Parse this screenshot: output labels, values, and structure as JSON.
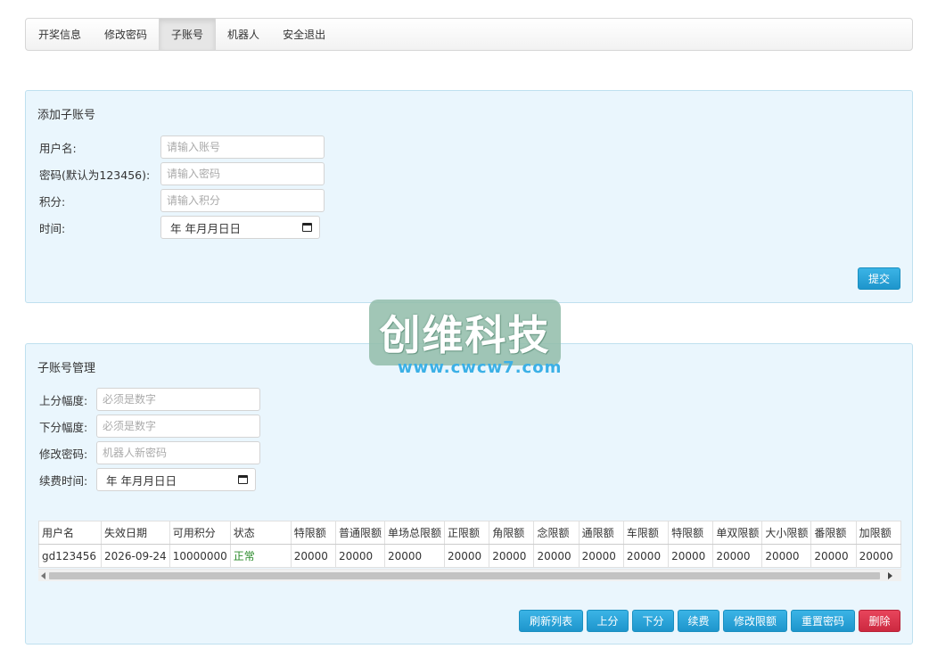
{
  "nav": {
    "items": [
      {
        "label": "开奖信息"
      },
      {
        "label": "修改密码"
      },
      {
        "label": "子账号"
      },
      {
        "label": "机器人"
      },
      {
        "label": "安全退出"
      }
    ],
    "active_index": 2
  },
  "add_panel": {
    "title": "添加子账号",
    "username_label": "用户名:",
    "username_placeholder": "请输入账号",
    "password_label": "密码(默认为123456):",
    "password_placeholder": "请输入密码",
    "points_label": "积分:",
    "points_placeholder": "请输入积分",
    "time_label": "时间:",
    "time_value": "年 年月月日日",
    "submit_label": "提交"
  },
  "manage_panel": {
    "title": "子账号管理",
    "up_label": "上分幅度:",
    "up_placeholder": "必须是数字",
    "down_label": "下分幅度:",
    "down_placeholder": "必须是数字",
    "pwd_label": "修改密码:",
    "pwd_placeholder": "机器人新密码",
    "renew_label": "续费时间:",
    "renew_value": "年 年月月日日",
    "table": {
      "headers": [
        "用户名",
        "失效日期",
        "可用积分",
        "状态",
        "特限额",
        "普通限额",
        "单场总限额",
        "正限额",
        "角限额",
        "念限额",
        "通限额",
        "车限额",
        "特限额",
        "单双限额",
        "大小限额",
        "番限额",
        "加限额"
      ],
      "rows": [
        [
          "gd123456",
          "2026-09-24",
          "10000000",
          "正常",
          "20000",
          "20000",
          "20000",
          "20000",
          "20000",
          "20000",
          "20000",
          "20000",
          "20000",
          "20000",
          "20000",
          "20000",
          "20000"
        ]
      ]
    },
    "buttons": {
      "refresh": "刷新列表",
      "up": "上分",
      "down": "下分",
      "renew": "续费",
      "limit": "修改限额",
      "reset_pwd": "重置密码",
      "delete": "删除"
    }
  },
  "watermark": {
    "title": "创维科技",
    "url": "www.cwcw7.com"
  },
  "colors": {
    "panel_bg": "#eaf6fd",
    "primary_btn": "#1e95cc",
    "danger_btn": "#cc2940",
    "status_ok": "#2a8a2a"
  }
}
